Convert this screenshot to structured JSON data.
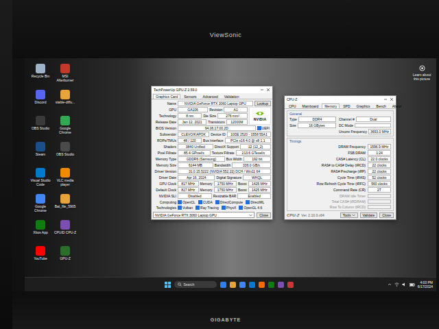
{
  "monitor": {
    "brand_top": "ViewSonic",
    "brand_bottom": "GIGABYTE"
  },
  "desktop": {
    "icons": [
      {
        "label": "Recycle Bin",
        "color": "#9fb3c8"
      },
      {
        "label": "MSI Afterburner",
        "color": "#c0392b"
      },
      {
        "label": "Discord",
        "color": "#5865f2"
      },
      {
        "label": "stable-diffu...",
        "color": "#e8a33a"
      },
      {
        "label": "OBS Studio",
        "color": "#3a3a3a"
      },
      {
        "label": "Google Chrome",
        "color": "#34a853"
      },
      {
        "label": "Steam",
        "color": "#1b4f8a"
      },
      {
        "label": "OBS Studio",
        "color": "#4a4a4a"
      },
      {
        "label": "Visual Studio Code",
        "color": "#007acc"
      },
      {
        "label": "VLC media player",
        "color": "#f08a00"
      },
      {
        "label": "Google Chrome",
        "color": "#4285f4"
      },
      {
        "label": "Bat_file_5905",
        "color": "#e8a33a"
      },
      {
        "label": "Xbox App",
        "color": "#107c10"
      },
      {
        "label": "CPUID CPU-Z",
        "color": "#7a4fb0"
      },
      {
        "label": "YouTube",
        "color": "#ff0000"
      },
      {
        "label": "GPU-Z",
        "color": "#2a6e2a"
      }
    ],
    "spotlight": {
      "label": "Learn about this picture"
    }
  },
  "gpuz": {
    "title": "TechPowerUp GPU-Z 2.59.0",
    "tabs": [
      {
        "label": "Graphics Card",
        "selected": true
      },
      {
        "label": "Sensors",
        "selected": false
      },
      {
        "label": "Advanced",
        "selected": false
      },
      {
        "label": "Validation",
        "selected": false
      }
    ],
    "name_row": {
      "label": "Name",
      "value": "NVIDIA GeForce RTX 3060 Laptop GPU",
      "button": "Lookup"
    },
    "logo": "NVIDIA",
    "top_rows": [
      {
        "label": "GPU",
        "fields": [
          {
            "value": "GA106"
          },
          {
            "label": "Revision",
            "value": "A1"
          }
        ]
      },
      {
        "label": "Technology",
        "fields": [
          {
            "value": "8 nm"
          },
          {
            "label": "Die Size",
            "value": "276 mm²"
          }
        ]
      },
      {
        "label": "Release Date",
        "fields": [
          {
            "value": "Jan 12, 2021"
          },
          {
            "label": "Transistors",
            "value": "12000M"
          }
        ]
      }
    ],
    "rows": [
      {
        "kind": "fields",
        "label": "BIOS Version",
        "fields": [
          {
            "value": "94.06.17.00.2D"
          }
        ],
        "flag": {
          "label": "UEFI",
          "checked": true
        }
      },
      {
        "kind": "fields",
        "label": "Subvendor",
        "fields": [
          {
            "value": "CLEVO/KAPOK"
          },
          {
            "label": "Device ID",
            "value": "10DE 2520 - 1558 55A1"
          }
        ]
      },
      {
        "kind": "fields",
        "label": "ROPs/TMUs",
        "fields": [
          {
            "value": "48 / 120"
          },
          {
            "label": "Bus Interface",
            "value": "PCIe x16 4.0 @ x8 1.1"
          }
        ]
      },
      {
        "kind": "fields",
        "label": "Shaders",
        "fields": [
          {
            "value": "3840 Unified"
          },
          {
            "label": "DirectX Support",
            "value": "12 (12_2)"
          }
        ]
      },
      {
        "kind": "fields",
        "label": "Pixel Fillrate",
        "fields": [
          {
            "value": "85.4 GPixel/s"
          },
          {
            "label": "Texture Fillrate",
            "value": "213.6 GTexel/s"
          }
        ]
      },
      {
        "kind": "fields",
        "label": "Memory Type",
        "fields": [
          {
            "value": "GDDR6 (Samsung)"
          },
          {
            "label": "Bus Width",
            "value": "192 bit"
          }
        ]
      },
      {
        "kind": "fields",
        "label": "Memory Size",
        "fields": [
          {
            "value": "6144 MB"
          },
          {
            "label": "Bandwidth",
            "value": "336.0 GB/s"
          }
        ]
      },
      {
        "kind": "fields",
        "label": "Driver Version",
        "fields": [
          {
            "value": "31.0.15.5222 (NVIDIA 552.22) DCH / Win11 64"
          }
        ]
      },
      {
        "kind": "fields",
        "label": "Driver Date",
        "fields": [
          {
            "value": "Apr 16, 2024"
          },
          {
            "label": "Digital Signature",
            "value": "WHQL"
          }
        ]
      },
      {
        "kind": "fields",
        "label": "GPU Clock",
        "fields": [
          {
            "value": "817 MHz"
          },
          {
            "label": "Memory",
            "value": "1750 MHz"
          },
          {
            "label": "Boost",
            "value": "1425 MHz"
          }
        ]
      },
      {
        "kind": "fields",
        "label": "Default Clock",
        "fields": [
          {
            "value": "817 MHz"
          },
          {
            "label": "Memory",
            "value": "1750 MHz"
          },
          {
            "label": "Boost",
            "value": "1425 MHz"
          }
        ]
      },
      {
        "kind": "fields",
        "label": "NVIDIA SLI",
        "fields": [
          {
            "value": "Disabled"
          },
          {
            "label": "Resizable BAR",
            "value": "Enabled"
          }
        ]
      },
      {
        "kind": "checks",
        "label": "Computing",
        "checks": [
          {
            "label": "OpenCL",
            "checked": true
          },
          {
            "label": "CUDA",
            "checked": true
          },
          {
            "label": "DirectCompute",
            "checked": true
          },
          {
            "label": "DirectML",
            "checked": true
          }
        ]
      },
      {
        "kind": "checks",
        "label": "Technologies",
        "checks": [
          {
            "label": "Vulkan",
            "checked": true
          },
          {
            "label": "Ray Tracing",
            "checked": true
          },
          {
            "label": "PhysX",
            "checked": true
          },
          {
            "label": "OpenGL 4.6",
            "checked": true
          }
        ]
      }
    ],
    "footer": {
      "select": "NVIDIA GeForce RTX 3060 Laptop GPU",
      "button": "Close"
    }
  },
  "cpuz": {
    "title": "CPU-Z",
    "tabs": [
      {
        "label": "CPU",
        "selected": false
      },
      {
        "label": "Mainboard",
        "selected": false
      },
      {
        "label": "Memory",
        "selected": true
      },
      {
        "label": "SPD",
        "selected": false
      },
      {
        "label": "Graphics",
        "selected": false
      },
      {
        "label": "Bench",
        "selected": false
      },
      {
        "label": "About",
        "selected": false
      }
    ],
    "general": {
      "legend": "General",
      "items": [
        {
          "label": "Type",
          "value": "DDR4"
        },
        {
          "label": "Channel #",
          "value": "Dual"
        },
        {
          "label": "Size",
          "value": "16 GBytes"
        },
        {
          "label": "DC Mode",
          "value": ""
        },
        {
          "label": "Uncore Frequency",
          "value": "3693.0 MHz"
        }
      ]
    },
    "timings": {
      "legend": "Timings",
      "rows": [
        {
          "label": "DRAM Frequency",
          "value": "1596.9 MHz",
          "disabled": false
        },
        {
          "label": "FSB:DRAM",
          "value": "1:24",
          "disabled": false
        },
        {
          "label": "CAS# Latency (CL)",
          "value": "22.0 clocks",
          "disabled": false
        },
        {
          "label": "RAS# to CAS# Delay (tRCD)",
          "value": "22 clocks",
          "disabled": false
        },
        {
          "label": "RAS# Precharge (tRP)",
          "value": "22 clocks",
          "disabled": false
        },
        {
          "label": "Cycle Time (tRAS)",
          "value": "52 clocks",
          "disabled": false
        },
        {
          "label": "Row Refresh Cycle Time (tRFC)",
          "value": "560 clocks",
          "disabled": false
        },
        {
          "label": "Command Rate (CR)",
          "value": "2T",
          "disabled": false
        },
        {
          "label": "DRAM Idle Timer",
          "value": "",
          "disabled": true
        },
        {
          "label": "Total CAS# (tRDRAM)",
          "value": "",
          "disabled": true
        },
        {
          "label": "Row To Column (tRCD)",
          "value": "",
          "disabled": true
        }
      ]
    },
    "footer": {
      "brand": "CPU-Z",
      "version": "Ver. 2.10.0.x64",
      "buttons": [
        "Tools",
        "Validate",
        "Close"
      ]
    }
  },
  "taskbar": {
    "search": "Search",
    "pinned": [
      {
        "color": "#2f80ed"
      },
      {
        "color": "#e8a33a"
      },
      {
        "color": "#4285f4"
      },
      {
        "color": "#0078d4"
      },
      {
        "color": "#ff6a00"
      },
      {
        "color": "#107c10"
      },
      {
        "color": "#7a4fb0"
      },
      {
        "color": "#d13438"
      }
    ],
    "time": "4:03 PM",
    "date": "6/17/2024"
  }
}
